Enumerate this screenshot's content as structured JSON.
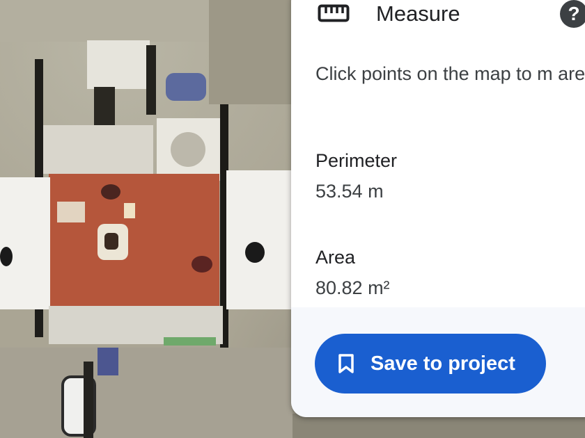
{
  "panel": {
    "icon": "ruler-icon",
    "title": "Measure",
    "help_icon": "help-icon",
    "help_glyph": "?",
    "instructions": "Click points on the map to m area",
    "metrics": [
      {
        "label": "Perimeter",
        "value": "53.54 m"
      },
      {
        "label": "Area",
        "value": "80.82 m²"
      }
    ],
    "save_button": {
      "icon": "bookmark-icon",
      "label": "Save to project"
    }
  },
  "colors": {
    "accent": "#1a5fd0",
    "roof": "#b5563b",
    "panel_bg": "#ffffff",
    "footer_bg": "#f6f8fc"
  }
}
